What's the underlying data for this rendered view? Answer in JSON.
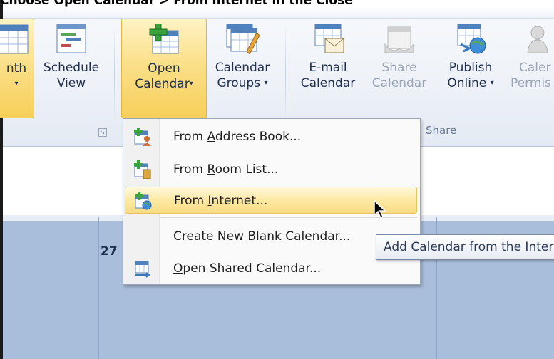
{
  "caption": "Choose Open Calendar > From Internet in the Close",
  "ribbon": {
    "buttons": [
      {
        "id": "month",
        "line1": "nth",
        "line2": "▾",
        "selected": true
      },
      {
        "id": "schedule",
        "line1": "Schedule",
        "line2": "View"
      },
      {
        "id": "open",
        "line1": "Open",
        "line2": "Calendar",
        "dropdown": "▾",
        "selected": true
      },
      {
        "id": "groups",
        "line1": "Calendar",
        "line2": "Groups",
        "dropdown": "▾"
      },
      {
        "id": "email",
        "line1": "E-mail",
        "line2": "Calendar"
      },
      {
        "id": "share",
        "line1": "Share",
        "line2": "Calendar",
        "disabled": true
      },
      {
        "id": "publish",
        "line1": "Publish",
        "line2": "Online",
        "dropdown": "▾"
      },
      {
        "id": "perm",
        "line1": "Caler",
        "line2": "Permis",
        "disabled": true
      }
    ],
    "group_label_share": "Share",
    "launcher_glyph": "↘"
  },
  "menu": {
    "items": [
      {
        "pre": "From ",
        "key": "A",
        "post": "ddress Book..."
      },
      {
        "pre": "From ",
        "key": "R",
        "post": "oom List..."
      },
      {
        "pre": "From ",
        "key": "I",
        "post": "nternet...",
        "highlighted": true
      },
      {
        "pre": "Create New ",
        "key": "B",
        "post": "lank Calendar..."
      },
      {
        "pre": "",
        "key": "O",
        "post": "pen Shared Calendar..."
      }
    ]
  },
  "tooltip": "Add Calendar from the Internet",
  "calendar": {
    "day_number": "27"
  },
  "colors": {
    "selected": "#f7cf5a",
    "calendar_bg": "#a9bedb",
    "highlight": "#fde9a4"
  }
}
